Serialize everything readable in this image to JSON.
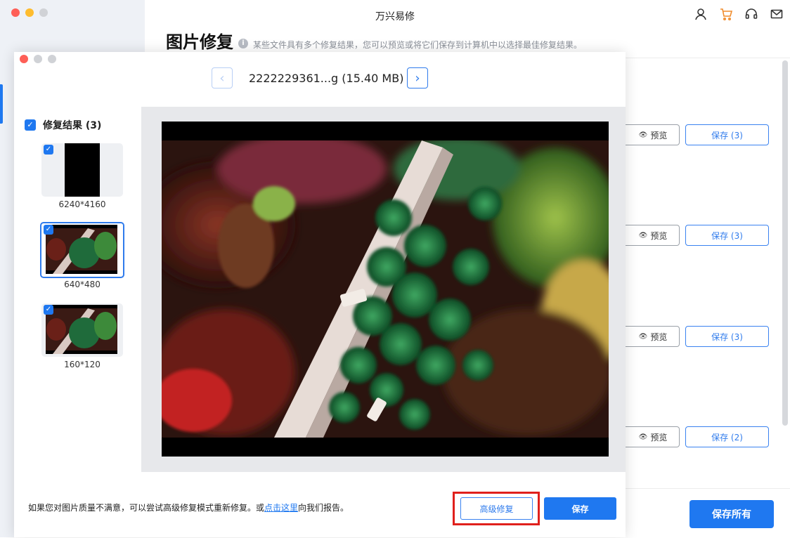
{
  "main_window": {
    "title": "万兴易修",
    "page_title": "图片修复",
    "info_text": "某些文件具有多个修复结果，您可以预览或将它们保存到计算机中以选择最佳修复结果。",
    "top_icons": [
      "user-icon",
      "cart-icon",
      "headset-icon",
      "mail-icon"
    ],
    "rows": [
      {
        "preview_label": "预览",
        "save_label": "保存 (3)"
      },
      {
        "preview_label": "预览",
        "save_label": "保存 (3)"
      },
      {
        "preview_label": "预览",
        "save_label": "保存 (3)"
      },
      {
        "preview_label": "预览",
        "save_label": "保存 (2)"
      }
    ],
    "save_all_label": "保存所有"
  },
  "dialog": {
    "file_name": "2222229361...g (15.40 MB)",
    "prev_icon": "chevron-left-icon",
    "next_icon": "chevron-right-icon",
    "results_label": "修复结果 (3)",
    "thumbnails": [
      {
        "label": "6240*4160",
        "checked": true,
        "selected": false
      },
      {
        "label": "640*480",
        "checked": true,
        "selected": true
      },
      {
        "label": "160*120",
        "checked": true,
        "selected": false
      }
    ],
    "footer_text_before": "如果您对图片质量不满意，可以尝试高级修复模式重新修复。或",
    "footer_link": "点击这里",
    "footer_text_after": "向我们报告。",
    "advanced_repair_label": "高级修复",
    "save_label": "保存"
  },
  "colors": {
    "accent": "#1f78f0",
    "highlight": "#e0201c",
    "cart": "#f08c2c"
  }
}
